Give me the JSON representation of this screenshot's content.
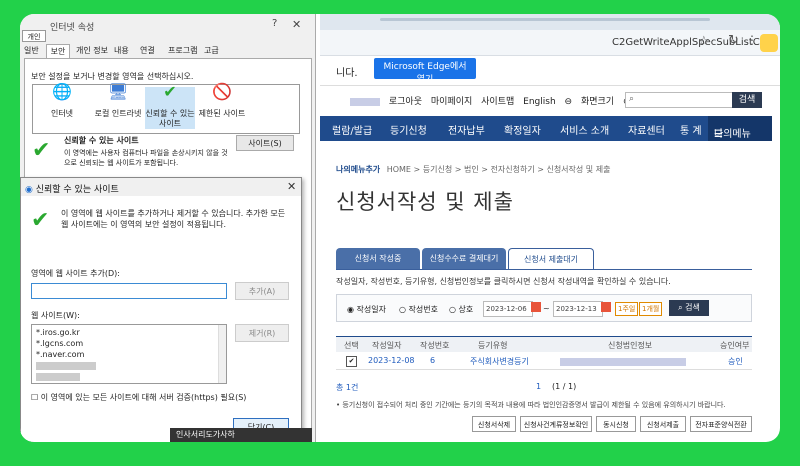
{
  "browser": {
    "url": "C2GetWriteApplSpecSubListC",
    "edge_prompt": "니다.",
    "edge_button": "Microsoft Edge에서 열기"
  },
  "util": {
    "logout": "로그아웃",
    "mypage": "마이페이지",
    "sitemap": "사이트맵",
    "english": "English",
    "zoom": "화면크기",
    "search_btn": "검색"
  },
  "nav": {
    "items": [
      "럴람/발급",
      "등기신청",
      "전자납부",
      "확정일자",
      "서비스 소개",
      "자료센터",
      "통 계"
    ],
    "mymenu": "나의메뉴"
  },
  "page": {
    "badge": "나의메뉴추가",
    "crumb": "HOME > 등기신청 > 법인 > 전자신청하기 > 신청서작성 및 제출",
    "title": "신청서작성 및 제출",
    "tabs": [
      "신청서 작성중",
      "신청수수료 결제대기",
      "신청서 제출대기"
    ],
    "instruction": "작성일자, 작성번호, 등기유형, 신청법인정보를 클릭하시면 신청서 작성내역을 확인하실 수 있습니다.",
    "filter": {
      "opt1": "작성일자",
      "opt2": "작성번호",
      "opt3": "상호",
      "from": "2023-12-06",
      "sep": "~",
      "to": "2023-12-13",
      "week": "1주일",
      "month": "1개월",
      "search": "검색"
    },
    "table": {
      "headers": [
        "선택",
        "작성일자",
        "작성번호",
        "등기유형",
        "신청법인정보",
        "승인여부"
      ],
      "rows": [
        {
          "check": "✔",
          "date": "2023-12-08",
          "no": "6",
          "type": "주식회사변경등기",
          "status": "승인"
        }
      ]
    },
    "total": "총 1건",
    "page_no": "1",
    "page_of": "(1 / 1)",
    "note": "• 등기신청이 접수되어 처리 중인 기간에는 등기의 목적과 내용에 따라 법인인감증명서 발급이 제한될 수 있음에 유의하시기 바랍니다.",
    "bottom_buttons": [
      "신청서삭제",
      "신청사건계류정보확인",
      "동시신청",
      "신청서제출",
      "전자표준양식전환"
    ]
  },
  "props": {
    "title": "인터넷 속성",
    "help": "?",
    "close": "✕",
    "gaein": "개인",
    "tabs": [
      "일반",
      "보안",
      "개인 정보",
      "내용",
      "연결",
      "프로그램",
      "고급"
    ],
    "instruction": "보안 설정을 보거나 변경할 영역을 선택하십시오.",
    "zones": [
      {
        "icon": "🌐",
        "label": "인터넷"
      },
      {
        "icon": "🖥",
        "label": "로컬 인트라넷"
      },
      {
        "icon": "✔",
        "label": "신뢰할 수 있는 사이트"
      },
      {
        "icon": "🚫",
        "label": "제한된 사이트"
      }
    ],
    "zone_title": "신뢰할 수 있는 사이트",
    "zone_desc": "이 영역에는 사용자 컴퓨터나 파일을 손상시키지 않을 것으로 신뢰되는 웹 사이트가 포함됩니다.",
    "sites_btn": "사이트(S)"
  },
  "trusted": {
    "title": "신뢰할 수 있는 사이트",
    "close": "✕",
    "desc": "이 영역에 웹 사이트를 추가하거나 제거할 수 있습니다. 추가한 모든 웹 사이트에는 이 영역의 보안 설정이 적용됩니다.",
    "add_label": "영역에 웹 사이트 추가(D):",
    "add_btn": "추가(A)",
    "list_label": "웹 사이트(W):",
    "sites": [
      "*.iros.go.kr",
      "*.lgcns.com",
      "*.naver.com"
    ],
    "remove_btn": "제거(R)",
    "https_label": "이 영역에 있는 모든 사이트에 대해 서버 검증(https) 필요(S)",
    "close_btn": "닫기(C)"
  },
  "taskbar_text": "인사서리도가사하"
}
